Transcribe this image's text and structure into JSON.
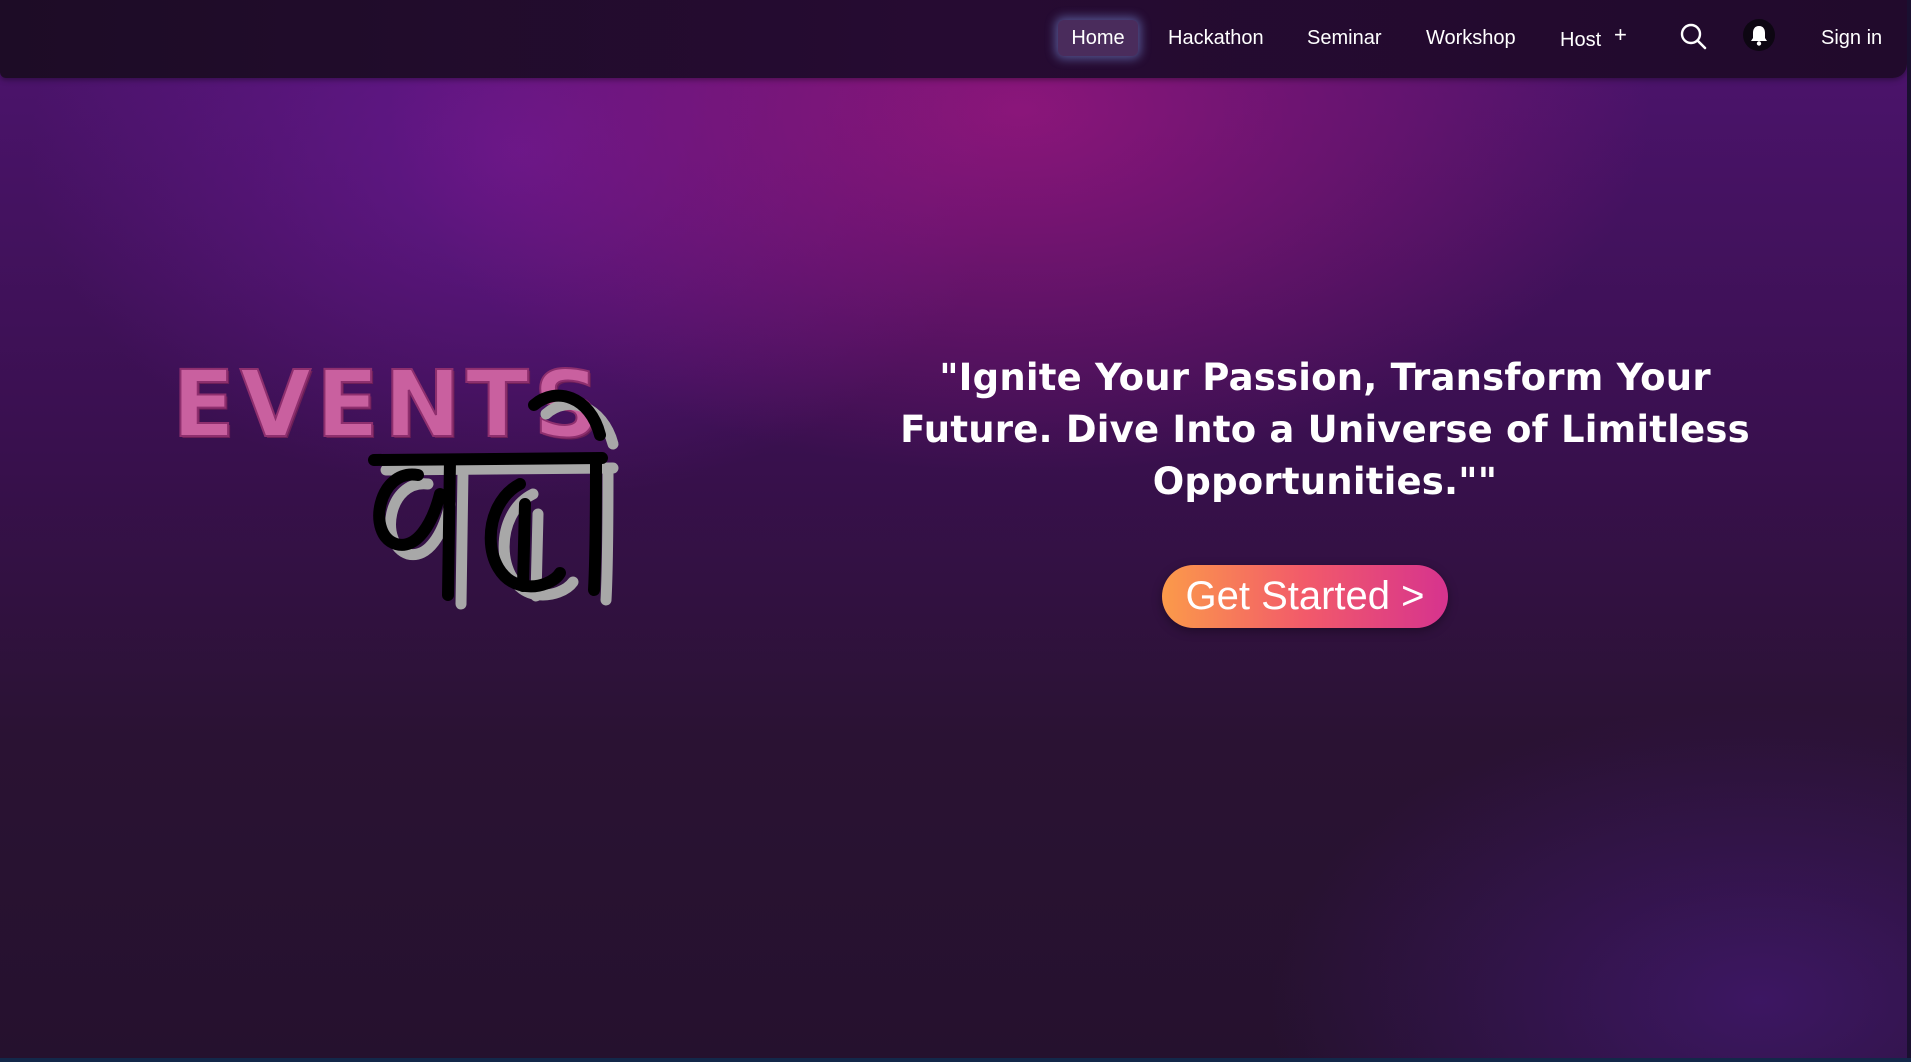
{
  "navbar": {
    "items": [
      {
        "label": "Home",
        "active": true
      },
      {
        "label": "Hackathon"
      },
      {
        "label": "Seminar"
      },
      {
        "label": "Workshop"
      },
      {
        "label": "Host"
      }
    ],
    "host_icon": "plus-icon",
    "search_icon": "search-icon",
    "notifications_icon": "bell-icon",
    "sign_in_label": "Sign in"
  },
  "logo": {
    "text": "EVENTS वाले",
    "accent_color": "#c9609f"
  },
  "hero": {
    "tagline": "\"Ignite Your Passion, Transform Your Future. Dive Into a Universe of Limitless Opportunities.\"\"",
    "cta_label": "Get Started >"
  },
  "colors": {
    "navbar_bg": "#260b32",
    "active_tab_bg": "#4a2c5c",
    "cta_gradient_start": "#fb9a4a",
    "cta_gradient_end": "#d6338e",
    "text": "#ffffff"
  }
}
